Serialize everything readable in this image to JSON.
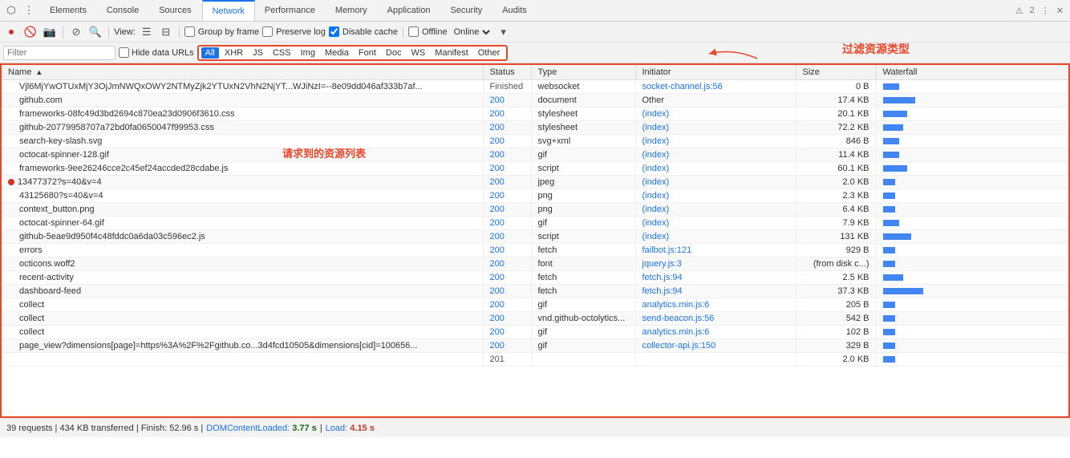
{
  "tabs": {
    "items": [
      {
        "id": "elements",
        "label": "Elements"
      },
      {
        "id": "console",
        "label": "Console"
      },
      {
        "id": "sources",
        "label": "Sources"
      },
      {
        "id": "network",
        "label": "Network",
        "active": true
      },
      {
        "id": "performance",
        "label": "Performance"
      },
      {
        "id": "memory",
        "label": "Memory"
      },
      {
        "id": "application",
        "label": "Application"
      },
      {
        "id": "security",
        "label": "Security"
      },
      {
        "id": "audits",
        "label": "Audits"
      }
    ],
    "warning_count": "2"
  },
  "toolbar": {
    "record_title": "Stop recording network log",
    "clear_title": "Clear",
    "capture_screenshot_title": "Capture screenshot",
    "filter_title": "Filter",
    "search_title": "Search",
    "view_label": "View:",
    "group_by_frame": "Group by frame",
    "preserve_log": "Preserve log",
    "disable_cache": "Disable cache",
    "offline": "Offline",
    "online": "Online"
  },
  "filter_bar": {
    "placeholder": "Filter",
    "hide_data_urls": "Hide data URLs",
    "types": [
      "All",
      "XHR",
      "JS",
      "CSS",
      "Img",
      "Media",
      "Font",
      "Doc",
      "WS",
      "Manifest",
      "Other"
    ],
    "active_type": "All"
  },
  "table": {
    "columns": [
      {
        "id": "name",
        "label": "Name"
      },
      {
        "id": "status",
        "label": "Status"
      },
      {
        "id": "type",
        "label": "Type"
      },
      {
        "id": "initiator",
        "label": "Initiator"
      },
      {
        "id": "size",
        "label": "Size"
      },
      {
        "id": "waterfall",
        "label": "Waterfall"
      }
    ],
    "rows": [
      {
        "name": "Vjl6MjYwOTUxMjY3OjJmNWQxOWY2NTMyZjk2YTUxN2VhN2NjYT...WJiNzI=--8e09dd046af333b7af...",
        "status": "Finished",
        "type": "websocket",
        "initiator": "socket-channel.js:56",
        "size": "0 B",
        "waterfall_w": 4
      },
      {
        "name": "github.com",
        "status": "200",
        "type": "document",
        "initiator": "Other",
        "size": "17.4 KB",
        "waterfall_w": 8
      },
      {
        "name": "frameworks-08fc49d3bd2694c870ea23d0906f3610.css",
        "status": "200",
        "type": "stylesheet",
        "initiator": "(index)",
        "size": "20.1 KB",
        "waterfall_w": 6
      },
      {
        "name": "github-20779958707a72bd0fa0650047f99953.css",
        "status": "200",
        "type": "stylesheet",
        "initiator": "(index)",
        "size": "72.2 KB",
        "waterfall_w": 5
      },
      {
        "name": "search-key-slash.svg",
        "status": "200",
        "type": "svg+xml",
        "initiator": "(index)",
        "size": "846 B",
        "waterfall_w": 4
      },
      {
        "name": "octocat-spinner-128.gif",
        "status": "200",
        "type": "gif",
        "initiator": "(index)",
        "size": "11.4 KB",
        "waterfall_w": 4
      },
      {
        "name": "frameworks-9ee26246cce2c45ef24accded28cdabe.js",
        "status": "200",
        "type": "script",
        "initiator": "(index)",
        "size": "60.1 KB",
        "waterfall_w": 6
      },
      {
        "name": "13477372?s=40&v=4",
        "status": "200",
        "type": "jpeg",
        "initiator": "(index)",
        "size": "2.0 KB",
        "waterfall_w": 3,
        "has_red_indicator": true
      },
      {
        "name": "43125680?s=40&v=4",
        "status": "200",
        "type": "png",
        "initiator": "(index)",
        "size": "2.3 KB",
        "waterfall_w": 3
      },
      {
        "name": "context_button.png",
        "status": "200",
        "type": "png",
        "initiator": "(index)",
        "size": "6.4 KB",
        "waterfall_w": 3
      },
      {
        "name": "octocat-spinner-64.gif",
        "status": "200",
        "type": "gif",
        "initiator": "(index)",
        "size": "7.9 KB",
        "waterfall_w": 4
      },
      {
        "name": "github-5eae9d950f4c48fddc0a6da03c596ec2.js",
        "status": "200",
        "type": "script",
        "initiator": "(index)",
        "size": "131 KB",
        "waterfall_w": 7
      },
      {
        "name": "errors",
        "status": "200",
        "type": "fetch",
        "initiator": "failbot.js:121",
        "size": "929 B",
        "waterfall_w": 3
      },
      {
        "name": "octicons.woff2",
        "status": "200",
        "type": "font",
        "initiator": "jquery.js:3",
        "size": "(from disk c...)",
        "waterfall_w": 3
      },
      {
        "name": "recent-activity",
        "status": "200",
        "type": "fetch",
        "initiator": "fetch.js:94",
        "size": "2.5 KB",
        "waterfall_w": 5
      },
      {
        "name": "dashboard-feed",
        "status": "200",
        "type": "fetch",
        "initiator": "fetch.js:94",
        "size": "37.3 KB",
        "waterfall_w": 10
      },
      {
        "name": "collect",
        "status": "200",
        "type": "gif",
        "initiator": "analytics.min.js:6",
        "size": "205 B",
        "waterfall_w": 3
      },
      {
        "name": "collect",
        "status": "200",
        "type": "vnd.github-octolytics...",
        "initiator": "send-beacon.js:56",
        "size": "542 B",
        "waterfall_w": 3
      },
      {
        "name": "collect",
        "status": "200",
        "type": "gif",
        "initiator": "analytics.min.js:6",
        "size": "102 B",
        "waterfall_w": 3
      },
      {
        "name": "page_view?dimensions[page]=https%3A%2F%2Fgithub.co...3d4fcd10505&dimensions[cid]=100656...",
        "status": "200",
        "type": "gif",
        "initiator": "collector-api.js:150",
        "size": "329 B",
        "waterfall_w": 3
      },
      {
        "name": "",
        "status": "201",
        "type": "",
        "initiator": "",
        "size": "2.0 KB",
        "waterfall_w": 3
      }
    ]
  },
  "annotations": {
    "filter_label": "过滤资源类型",
    "list_label": "请求到的资源列表"
  },
  "status_bar": {
    "text": "39 requests | 434 KB transferred | Finish: 52.96 s | ",
    "dom_content_loaded_label": "DOMContentLoaded:",
    "dom_content_loaded_value": "3.77 s",
    "load_label": "Load:",
    "load_value": "4.15 s"
  }
}
